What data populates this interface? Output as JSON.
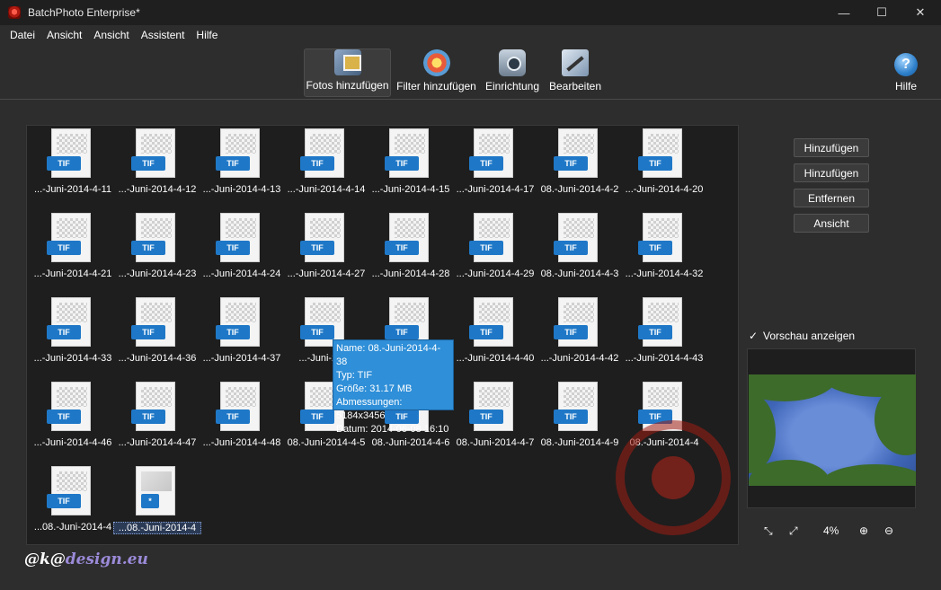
{
  "window": {
    "title": "BatchPhoto Enterprise*",
    "minimize_glyph": "—",
    "maximize_glyph": "☐",
    "close_glyph": "✕"
  },
  "menu": [
    {
      "label": "Datei"
    },
    {
      "label": "Ansicht"
    },
    {
      "label": "Ansicht"
    },
    {
      "label": "Assistent"
    },
    {
      "label": "Hilfe"
    }
  ],
  "toolbar": {
    "add_photos": {
      "label": "Fotos hinzufügen",
      "icon": "photos-icon"
    },
    "add_filters": {
      "label": "Filter hinzufügen",
      "icon": "filter-icon"
    },
    "setup": {
      "label": "Einrichtung",
      "icon": "camera-setup-icon"
    },
    "edit": {
      "label": "Bearbeiten",
      "icon": "edit-icon"
    },
    "help": {
      "label": "Hilfe",
      "icon": "help-icon",
      "glyph": "?"
    }
  },
  "gallery": {
    "files": [
      {
        "label": "...-Juni-2014-4-11",
        "type": "TIF"
      },
      {
        "label": "...-Juni-2014-4-12",
        "type": "TIF"
      },
      {
        "label": "...-Juni-2014-4-13",
        "type": "TIF"
      },
      {
        "label": "...-Juni-2014-4-14",
        "type": "TIF"
      },
      {
        "label": "...-Juni-2014-4-15",
        "type": "TIF"
      },
      {
        "label": "...-Juni-2014-4-17",
        "type": "TIF"
      },
      {
        "label": "08.-Juni-2014-4-2",
        "type": "TIF"
      },
      {
        "label": "...-Juni-2014-4-20",
        "type": "TIF"
      },
      {
        "label": "...-Juni-2014-4-21",
        "type": "TIF"
      },
      {
        "label": "...-Juni-2014-4-23",
        "type": "TIF"
      },
      {
        "label": "...-Juni-2014-4-24",
        "type": "TIF"
      },
      {
        "label": "...-Juni-2014-4-27",
        "type": "TIF"
      },
      {
        "label": "...-Juni-2014-4-28",
        "type": "TIF"
      },
      {
        "label": "...-Juni-2014-4-29",
        "type": "TIF"
      },
      {
        "label": "08.-Juni-2014-4-3",
        "type": "TIF"
      },
      {
        "label": "...-Juni-2014-4-32",
        "type": "TIF"
      },
      {
        "label": "...-Juni-2014-4-33",
        "type": "TIF"
      },
      {
        "label": "...-Juni-2014-4-36",
        "type": "TIF"
      },
      {
        "label": "...-Juni-2014-4-37",
        "type": "TIF"
      },
      {
        "label": "...-Juni-2014",
        "type": "TIF"
      },
      {
        "label": "",
        "type": "TIF"
      },
      {
        "label": "...-Juni-2014-4-40",
        "type": "TIF"
      },
      {
        "label": "...-Juni-2014-4-42",
        "type": "TIF"
      },
      {
        "label": "...-Juni-2014-4-43",
        "type": "TIF"
      },
      {
        "label": "...-Juni-2014-4-46",
        "type": "TIF"
      },
      {
        "label": "...-Juni-2014-4-47",
        "type": "TIF"
      },
      {
        "label": "...-Juni-2014-4-48",
        "type": "TIF"
      },
      {
        "label": "08.-Juni-2014-4-5",
        "type": "TIF"
      },
      {
        "label": "08.-Juni-2014-4-6",
        "type": "TIF"
      },
      {
        "label": "08.-Juni-2014-4-7",
        "type": "TIF"
      },
      {
        "label": "08.-Juni-2014-4-9",
        "type": "TIF"
      },
      {
        "label": "08.-Juni-2014-4",
        "type": "TIF"
      },
      {
        "label": "...08.-Juni-2014-4",
        "type": "TIF"
      },
      {
        "label": "...08.-Juni-2014-4",
        "type": "*",
        "selected": true
      }
    ],
    "tooltip": {
      "name": "Name: 08.-Juni-2014-4-38",
      "type": "Typ: TIF",
      "size": "Größe: 31.17 MB",
      "dimensions": "Abmessungen: 5184x3456",
      "date": "Datum: 2014-06-08 16:10"
    }
  },
  "side_buttons": [
    {
      "label": "Hinzufügen"
    },
    {
      "label": "Hinzufügen"
    },
    {
      "label": "Entfernen"
    },
    {
      "label": "Ansicht"
    }
  ],
  "preview": {
    "checkbox_checked": true,
    "checkbox_glyph": "✓",
    "label": "Vorschau anzeigen",
    "zoom": "4%"
  },
  "watermark": {
    "prefix": "@k@",
    "brand": "design.eu"
  },
  "colors": {
    "accent": "#2f8fd8",
    "badge": "#1f78c7"
  }
}
